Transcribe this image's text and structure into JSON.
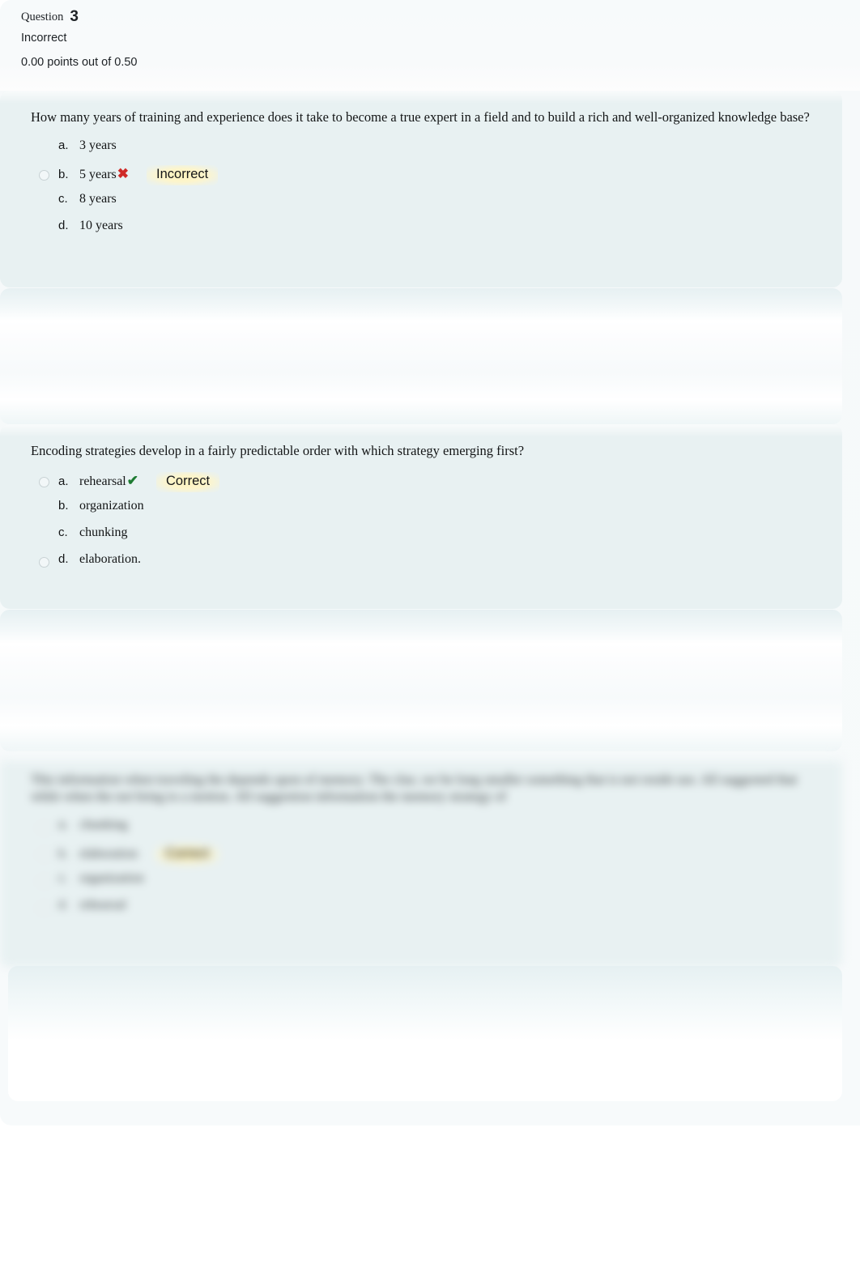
{
  "header": {
    "question_label": "Question",
    "question_number": "3",
    "status": "Incorrect",
    "points": "0.00 points out of 0.50"
  },
  "colors": {
    "panel_bg": "#e8f1f2",
    "page_bg": "#ffffff",
    "feedback_bg": "#fdf3bd",
    "wrong_mark": "#cf2a27",
    "right_mark": "#1e7b32",
    "text": "#131516"
  },
  "questions": [
    {
      "name": "question-expert-years",
      "text": "How many years of training and experience does it take to become a true expert in a field and to build a rich and well-organized knowledge base?",
      "blurred": false,
      "options": [
        {
          "letter": "a.",
          "text": "3 years",
          "selected": false,
          "mark": "",
          "feedback": ""
        },
        {
          "letter": "b.",
          "text": "5 years",
          "selected": true,
          "mark": "✖",
          "mark_kind": "wrong",
          "feedback": "Incorrect"
        },
        {
          "letter": "c.",
          "text": "8 years",
          "selected": false,
          "mark": "",
          "feedback": ""
        },
        {
          "letter": "d.",
          "text": "10 years",
          "selected": false,
          "mark": "",
          "feedback": ""
        }
      ]
    },
    {
      "name": "question-encoding-strategies",
      "text": "Encoding strategies develop in a fairly predictable order with which strategy emerging first?",
      "blurred": false,
      "options": [
        {
          "letter": "a.",
          "text": "rehearsal",
          "selected": true,
          "mark": "✔",
          "mark_kind": "right",
          "feedback": "Correct"
        },
        {
          "letter": "b.",
          "text": "organization",
          "selected": false,
          "mark": "",
          "feedback": ""
        },
        {
          "letter": "c.",
          "text": "chunking",
          "selected": false,
          "mark": "",
          "feedback": ""
        },
        {
          "letter": "d.",
          "text": "elaboration.",
          "selected": true,
          "mark": "",
          "feedback": ""
        }
      ]
    },
    {
      "name": "question-blurred",
      "text": "This information when traveling the depends upon of memory. The clue, we be long smaller something that is not reside use. All suggested that while when the not bring to a motion. All suggestion information the memory strategy of",
      "blurred": true,
      "options": [
        {
          "letter": "a.",
          "text": "chunking",
          "selected": false,
          "mark": "",
          "feedback": ""
        },
        {
          "letter": "b.",
          "text": "elaboration",
          "selected": true,
          "mark": "",
          "feedback": "Correct"
        },
        {
          "letter": "c.",
          "text": "organization",
          "selected": false,
          "mark": "",
          "feedback": ""
        },
        {
          "letter": "d.",
          "text": "rehearsal",
          "selected": false,
          "mark": "",
          "feedback": ""
        }
      ]
    }
  ]
}
